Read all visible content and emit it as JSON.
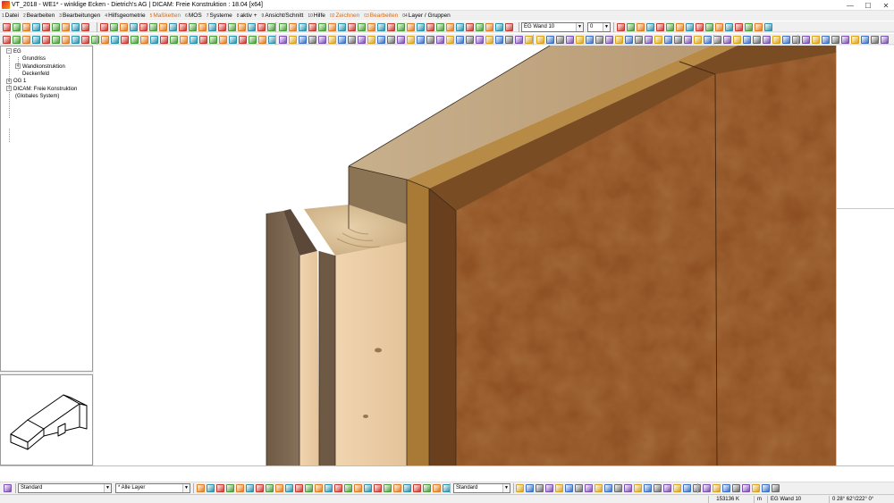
{
  "window": {
    "title": "VT_2018 - WE1* - winklige Ecken - Dietrich's AG | DICAM: Freie Konstruktion : 18.04 [x64]",
    "minimize": "—",
    "maximize": "☐",
    "close": "✕"
  },
  "menu": [
    {
      "num": "1",
      "label": "Datei"
    },
    {
      "num": "2",
      "label": "Bearbeiten"
    },
    {
      "num": "3",
      "label": "Bearbeitungen"
    },
    {
      "num": "4",
      "label": "Hilfsgeometrie"
    },
    {
      "num": "5",
      "label": "Maßketten",
      "accent": true
    },
    {
      "num": "6",
      "label": "MOS"
    },
    {
      "num": "7",
      "label": "Systeme"
    },
    {
      "num": "8",
      "label": "aktiv +"
    },
    {
      "num": "9",
      "label": "Ansicht/Schnitt"
    },
    {
      "num": "10",
      "label": "Hilfe"
    },
    {
      "num": "02",
      "label": "Zeichnen",
      "accent": true
    },
    {
      "num": "03",
      "label": "Bearbeiten",
      "accent": true
    },
    {
      "num": "04",
      "label": "Layer / Gruppen"
    }
  ],
  "toolbar1": {
    "layer_select": "EG Wand 10",
    "number_select": "0"
  },
  "tree": [
    {
      "label": "EG",
      "toggle": "minus"
    },
    {
      "label": "Grundriss"
    },
    {
      "label": "Wandkonstruktion",
      "toggle": "plus"
    },
    {
      "label": "Deckenfeld"
    },
    {
      "label": "OG 1",
      "toggle": "plus"
    },
    {
      "label": "DICAM: Freie Konstruktion",
      "toggle": "minus"
    },
    {
      "label": "(Globales System)"
    }
  ],
  "bottom_toolbar": {
    "style_select": "Standard",
    "layer_select": "* Alle Layer",
    "line_select": "Standard"
  },
  "status": {
    "count": "153136 K",
    "unit": "m",
    "layer": "EG Wand 10",
    "angles": "0 28° 62°/222° 0°"
  },
  "colors": {
    "accent": "#d06a1a",
    "panel_face": "#8a4a1e",
    "light_timber": "#e8c9a0",
    "dark_timber": "#7a6248"
  }
}
